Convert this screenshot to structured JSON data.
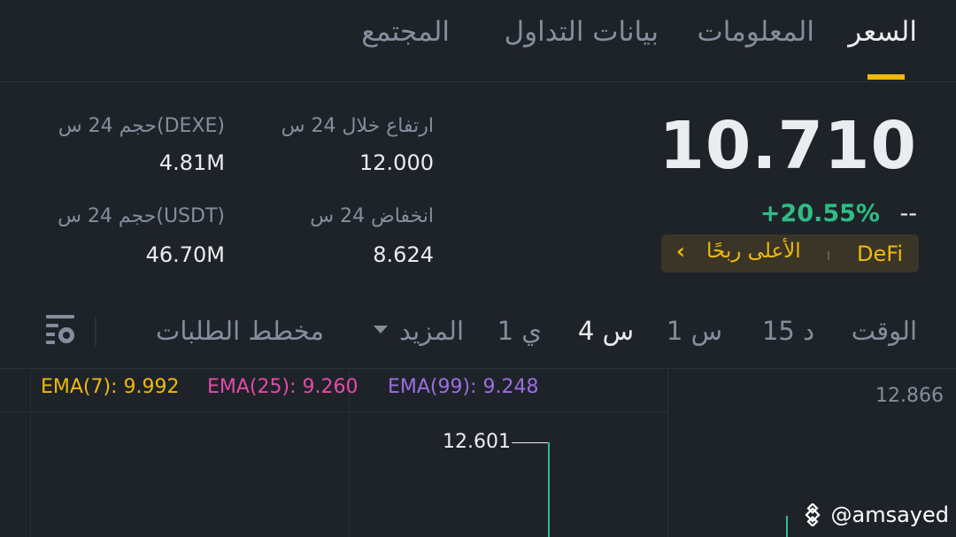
{
  "tabs": [
    {
      "label": "السعر",
      "active": true
    },
    {
      "label": "المعلومات",
      "active": false
    },
    {
      "label": "بيانات التداول",
      "active": false
    },
    {
      "label": "المجتمع",
      "active": false
    }
  ],
  "price": {
    "last": "10.710",
    "change_pct": "+20.55%",
    "fiat": "--",
    "tag": {
      "category": "DeFi",
      "label": "الأعلى ربحًا"
    }
  },
  "stats": {
    "high_label": "ارتفاع خلال 24 س",
    "high_value": "12.000",
    "low_label": "انخفاض 24 س",
    "low_value": "8.624",
    "vol_base_label": "حجم 24 س(DEXE)",
    "vol_base_value": "4.81M",
    "vol_quote_label": "حجم 24 س(USDT)",
    "vol_quote_value": "46.70M"
  },
  "timeframes": {
    "time_label": "الوقت",
    "options": [
      "15 د",
      "1 س",
      "4 س",
      "1 ي"
    ],
    "selected": "4 س",
    "more_label": "المزيد",
    "depth_label": "مخطط الطلبات"
  },
  "chart": {
    "ema7": "EMA(7): 9.992",
    "ema25": "EMA(25): 9.260",
    "ema99": "EMA(99): 9.248",
    "axis_top": "12.866",
    "peak": "12.601",
    "colors": {
      "ema7": "#f0b90b",
      "ema25": "#e649a7",
      "ema99": "#9c6ee0",
      "up": "#2ebd85"
    }
  },
  "watermark": "@amsayed"
}
